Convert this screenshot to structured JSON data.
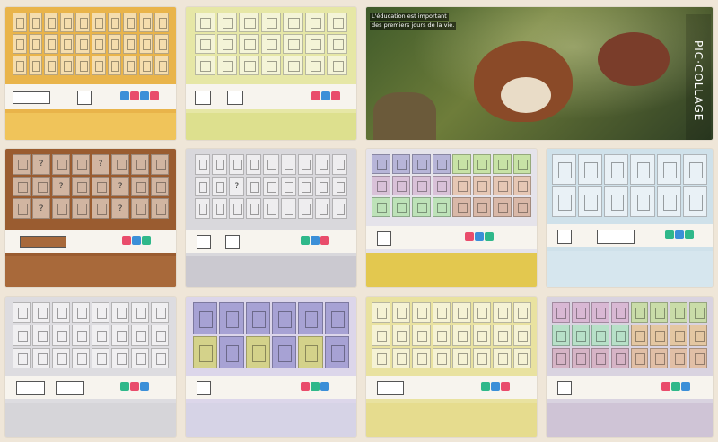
{
  "collage": {
    "brand_label": "PIC·COLLAGE",
    "caption_line1": "L'éducation est important",
    "caption_line2": "des premiers jours de la vie."
  },
  "tiles": [
    {
      "name": "tile-yellow-blocks",
      "top": "#e9b44a",
      "bottom": "#e9b44a"
    },
    {
      "name": "tile-lime-shapes",
      "top": "#e6e7a6",
      "bottom": "#d8df8e"
    },
    {
      "name": "tile-brown-arrows",
      "top": "#9a5c30",
      "bottom": "#a8693a"
    },
    {
      "name": "tile-gray-squares",
      "top": "#d9d8dc",
      "bottom": "#c9c8cc"
    },
    {
      "name": "tile-colored-grid",
      "top": "#c9c6d4",
      "bottom": "#d7c65a"
    },
    {
      "name": "tile-blue-shapes",
      "top": "#cfe1ea",
      "bottom": "#d6e6ee"
    },
    {
      "name": "tile-gray-lines",
      "top": "#dddce0",
      "bottom": "#d6d5d9"
    },
    {
      "name": "tile-lavender-pentagons",
      "top": "#dcd6ea",
      "bottom": "#d6d3e6"
    },
    {
      "name": "tile-yellow-lines",
      "top": "#e9e2a0",
      "bottom": "#e6dc8e"
    },
    {
      "name": "tile-pastel-squares",
      "top": "#d9d3e0",
      "bottom": "#d9cfd8"
    }
  ]
}
